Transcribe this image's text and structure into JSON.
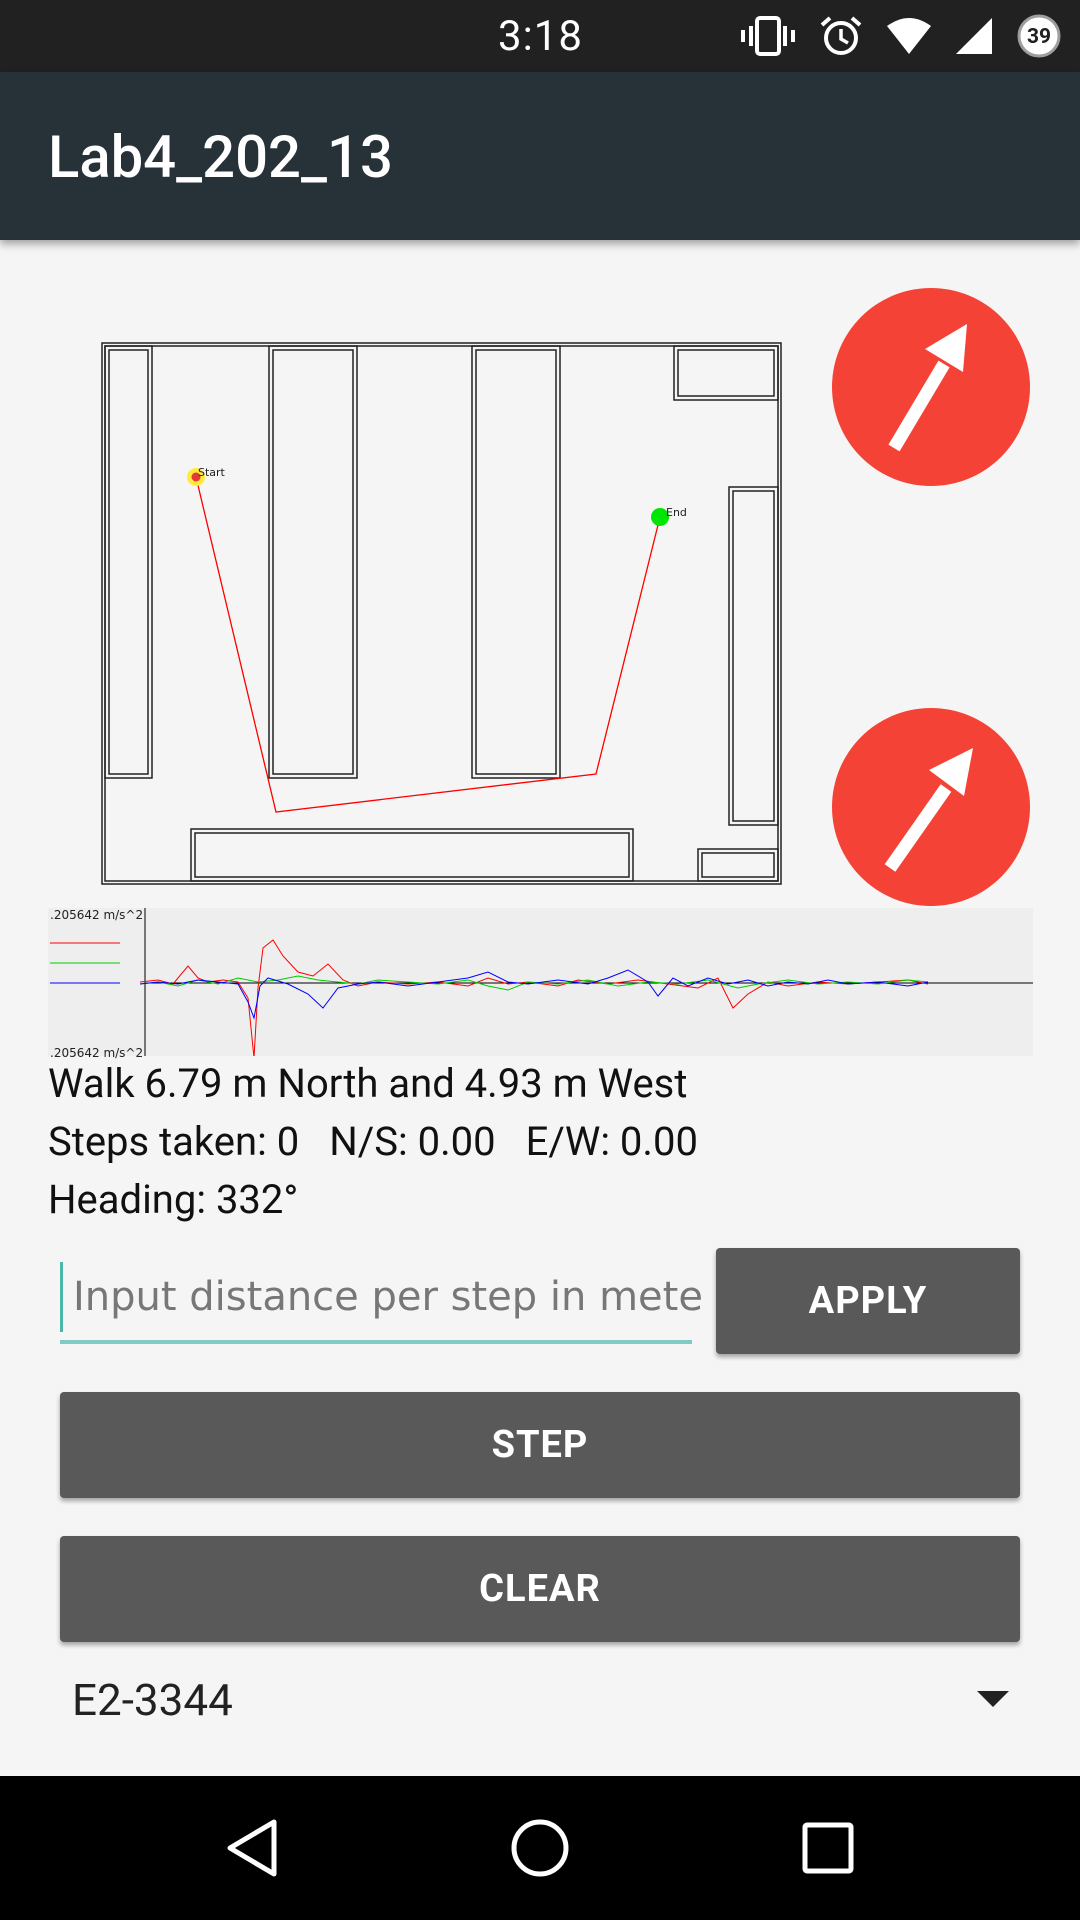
{
  "status_bar": {
    "time": "3:18",
    "battery_level": "39",
    "icons": [
      "vibrate-icon",
      "alarm-icon",
      "wifi-icon",
      "cell-signal-icon",
      "battery-icon"
    ]
  },
  "app_bar": {
    "title": "Lab4_202_13"
  },
  "map": {
    "start_label": "Start",
    "end_label": "End"
  },
  "fabs": [
    {
      "icon": "north-east-arrow-icon"
    },
    {
      "icon": "north-east-arrow-icon"
    }
  ],
  "graph": {
    "top_label": ".205642 m/s^2",
    "bottom_label": ".205642 m/s^2",
    "series_colors": [
      "#ff0000",
      "#00cc00",
      "#0000ff"
    ]
  },
  "info": {
    "instruction": "Walk 6.79 m North and 4.93 m West",
    "steps": "Steps taken: 0",
    "ns": "N/S: 0.00",
    "ew": "E/W: 0.00",
    "heading": "Heading: 332°"
  },
  "controls": {
    "distance_placeholder": "Input distance per step in meters",
    "distance_value": "",
    "apply_label": "APPLY",
    "step_label": "STEP",
    "clear_label": "CLEAR",
    "map_selected": "E2-3344"
  },
  "nav_bar": {
    "icons": [
      "back-icon",
      "home-icon",
      "recents-icon"
    ]
  },
  "colors": {
    "app_bar": "#263238",
    "fab": "#f44336",
    "button": "#595959",
    "input_underline": "#80cbc4"
  }
}
